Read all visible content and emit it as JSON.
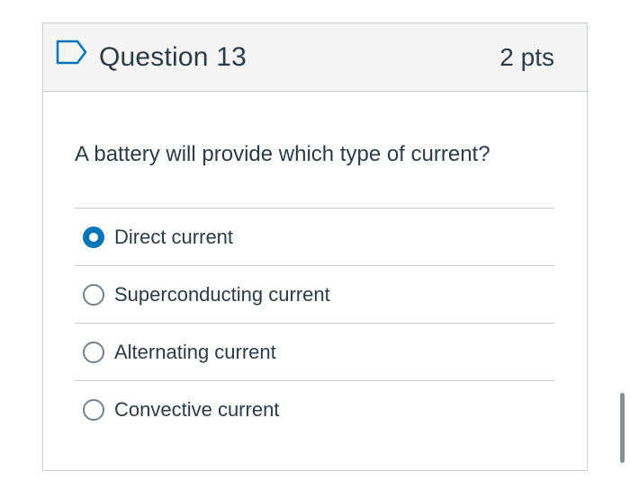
{
  "question": {
    "title": "Question 13",
    "points": "2 pts",
    "text": "A battery will provide which type of current?",
    "flag_icon": "flag-outline-icon",
    "accent_color": "#0374b5"
  },
  "answers": [
    {
      "label": "Direct current",
      "selected": true
    },
    {
      "label": "Superconducting current",
      "selected": false
    },
    {
      "label": "Alternating current",
      "selected": false
    },
    {
      "label": "Convective current",
      "selected": false
    }
  ]
}
